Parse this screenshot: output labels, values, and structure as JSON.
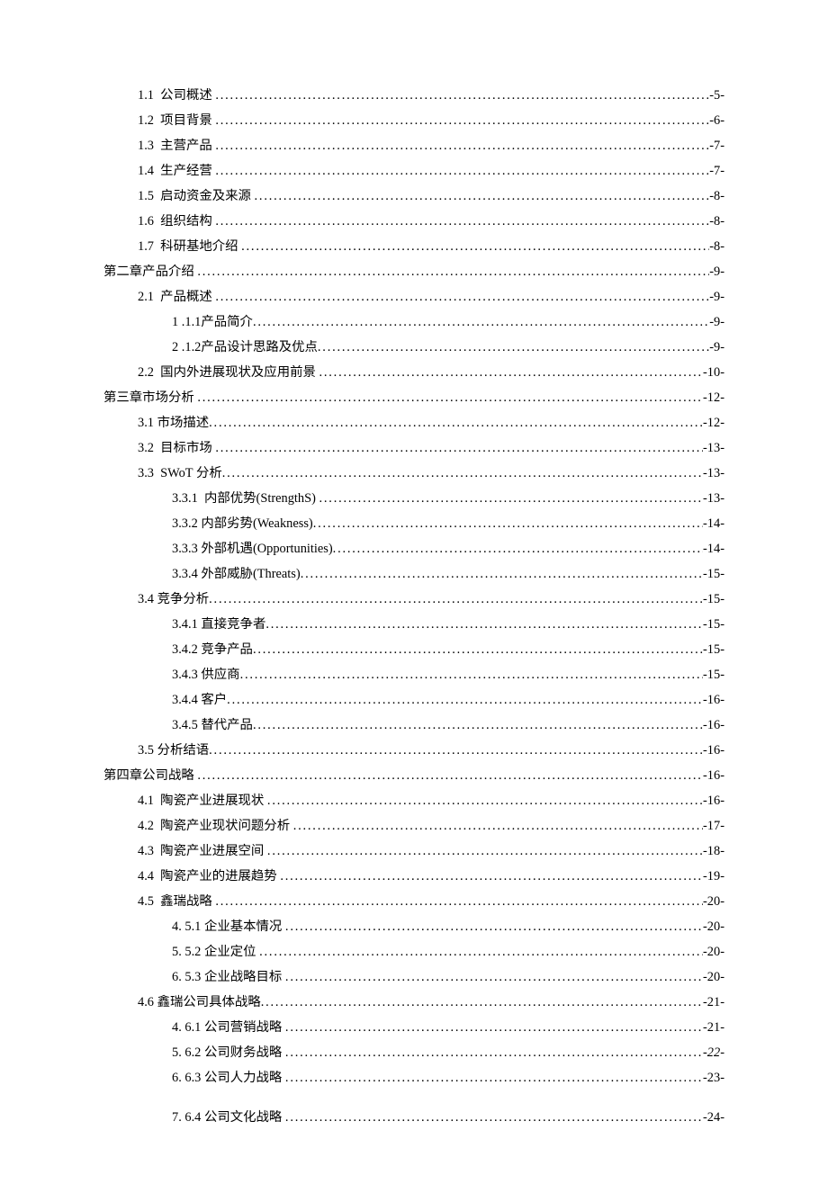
{
  "toc": [
    {
      "level": 2,
      "label": "1.1  公司概述 ",
      "page": "-5-"
    },
    {
      "level": 2,
      "label": "1.2  项目背景 ",
      "page": "-6-"
    },
    {
      "level": 2,
      "label": "1.3  主营产品 ",
      "page": "-7-"
    },
    {
      "level": 2,
      "label": "1.4  生产经营 ",
      "page": "-7-"
    },
    {
      "level": 2,
      "label": "1.5  启动资金及来源 ",
      "page": "-8-"
    },
    {
      "level": 2,
      "label": "1.6  组织结构 ",
      "page": "-8-"
    },
    {
      "level": 2,
      "label": "1.7  科研基地介绍 ",
      "page": "-8-"
    },
    {
      "level": 1,
      "label": "第二章产品介绍 ",
      "page": "-9-"
    },
    {
      "level": 2,
      "label": "2.1  产品概述 ",
      "page": "-9-"
    },
    {
      "level": 3,
      "label": "1 .1.1产品简介",
      "page": "-9-"
    },
    {
      "level": 3,
      "label": "2 .1.2产品设计思路及优点",
      "page": "-9-"
    },
    {
      "level": 2,
      "label": "2.2  国内外进展现状及应用前景 ",
      "page": "-10-"
    },
    {
      "level": 1,
      "label": "第三章市场分析 ",
      "page": "-12-"
    },
    {
      "level": 2,
      "label": "3.1 市场描述",
      "page": "-12-"
    },
    {
      "level": 2,
      "label": "3.2  目标市场 ",
      "page": "-13-"
    },
    {
      "level": 2,
      "label": "3.3  SWoT 分析",
      "page": "-13-"
    },
    {
      "level": 3,
      "label": "3.3.1  内部优势(StrengthS) ",
      "page": "-13-"
    },
    {
      "level": 3,
      "label": "3.3.2 内部劣势(Weakness)",
      "page": "-14-"
    },
    {
      "level": 3,
      "label": "3.3.3 外部机遇(Opportunities)",
      "page": "-14-"
    },
    {
      "level": 3,
      "label": "3.3.4 外部威胁(Threats)",
      "page": "-15-"
    },
    {
      "level": 2,
      "label": "3.4 竞争分析",
      "page": "-15-"
    },
    {
      "level": 3,
      "label": "3.4.1 直接竞争者",
      "page": "-15-"
    },
    {
      "level": 3,
      "label": "3.4.2 竞争产品",
      "page": "-15-"
    },
    {
      "level": 3,
      "label": "3.4.3 供应商",
      "page": "-15-"
    },
    {
      "level": 3,
      "label": "3.4.4 客户",
      "page": "-16-"
    },
    {
      "level": 3,
      "label": "3.4.5 替代产品",
      "page": "-16-"
    },
    {
      "level": 2,
      "label": "3.5 分析结语",
      "page": "-16-"
    },
    {
      "level": 1,
      "label": "第四章公司战略 ",
      "page": "-16-"
    },
    {
      "level": 2,
      "label": "4.1  陶瓷产业进展现状 ",
      "page": "-16-"
    },
    {
      "level": 2,
      "label": "4.2  陶瓷产业现状问题分析 ",
      "page": "-17-"
    },
    {
      "level": 2,
      "label": "4.3  陶瓷产业进展空间 ",
      "page": "-18-"
    },
    {
      "level": 2,
      "label": "4.4  陶瓷产业的进展趋势 ",
      "page": "-19-"
    },
    {
      "level": 2,
      "label": "4.5  鑫瑞战略 ",
      "page": "-20-"
    },
    {
      "level": 3,
      "label": "4. 5.1 企业基本情况 ",
      "page": "-20-"
    },
    {
      "level": 3,
      "label": "5. 5.2 企业定位 ",
      "page": "-20-"
    },
    {
      "level": 3,
      "label": "6. 5.3 企业战略目标 ",
      "page": "-20-"
    },
    {
      "level": 2,
      "label": "4.6 鑫瑞公司具体战略",
      "page": "-21-"
    },
    {
      "level": 3,
      "label": "4. 6.1 公司营销战略 ",
      "page": "-21-"
    },
    {
      "level": 3,
      "label": "5. 6.2 公司财务战略 ",
      "page": "-22-",
      "italicPage": true
    },
    {
      "level": 3,
      "label": "6. 6.3 公司人力战略 ",
      "page": "-23-"
    },
    {
      "level": 3,
      "label": "7. 6.4 公司文化战略 ",
      "page": "-24-",
      "gapBefore": true
    }
  ]
}
